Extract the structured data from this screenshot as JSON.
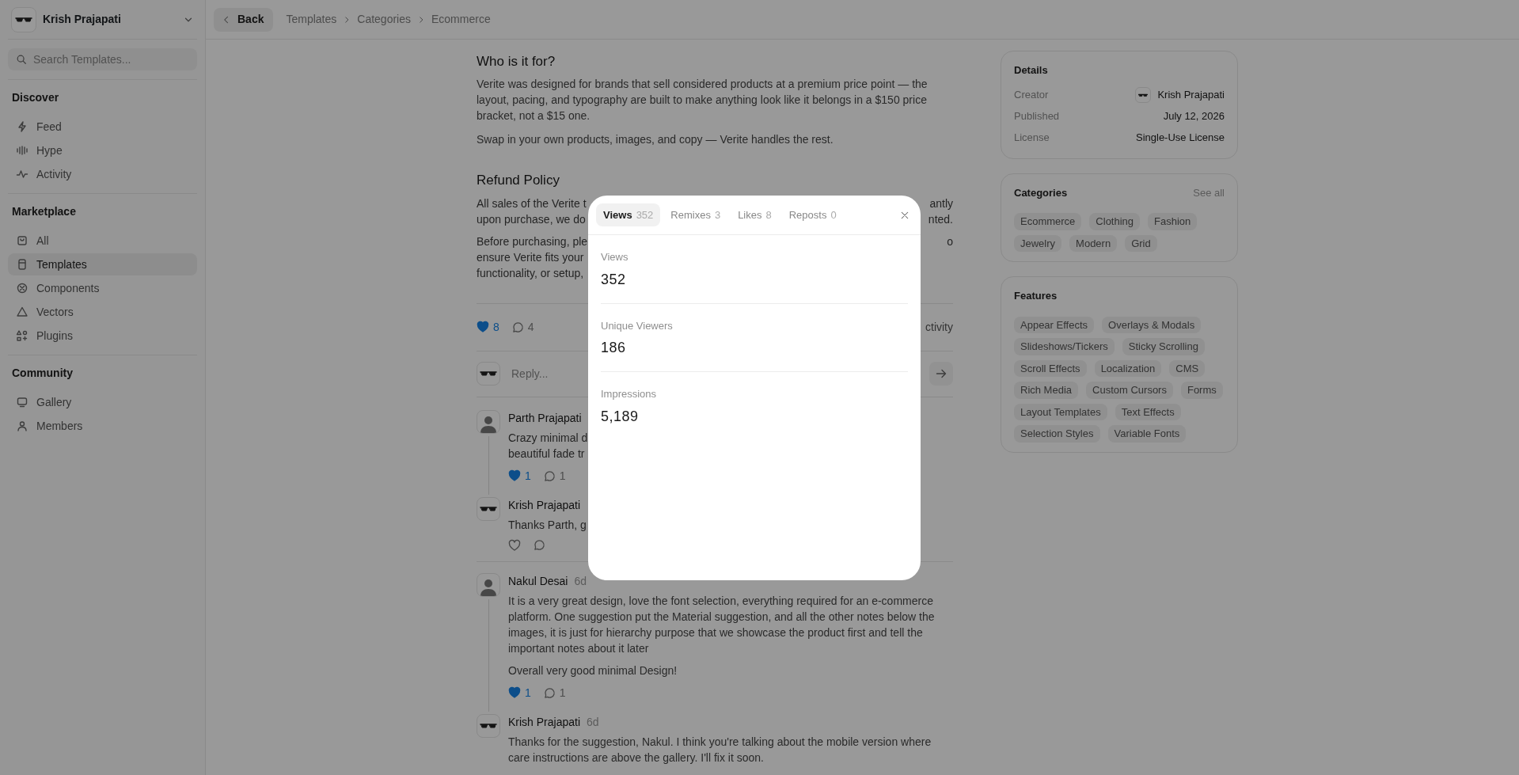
{
  "sidebar": {
    "profile": {
      "name": "Krish Prajapati"
    },
    "search": {
      "placeholder": "Search Templates..."
    },
    "sections": [
      {
        "title": "Discover",
        "items": [
          {
            "label": "Feed",
            "selected": false
          },
          {
            "label": "Hype",
            "selected": false
          },
          {
            "label": "Activity",
            "selected": false
          }
        ]
      },
      {
        "title": "Marketplace",
        "items": [
          {
            "label": "All",
            "selected": false
          },
          {
            "label": "Templates",
            "selected": true
          },
          {
            "label": "Components",
            "selected": false
          },
          {
            "label": "Vectors",
            "selected": false
          },
          {
            "label": "Plugins",
            "selected": false
          }
        ]
      },
      {
        "title": "Community",
        "items": [
          {
            "label": "Gallery",
            "selected": false
          },
          {
            "label": "Members",
            "selected": false
          }
        ]
      }
    ]
  },
  "topbar": {
    "back": "Back",
    "breadcrumb": [
      "Templates",
      "Categories",
      "Ecommerce"
    ]
  },
  "article": [
    {
      "heading": "Who is it for?",
      "paragraphs": [
        {
          "text": "Verite was designed for brands that sell considered products at a premium price point — the layout, pacing, and typography are built to make anything look like it belongs in a $150 price bracket, not a $15 one."
        },
        {
          "text": "Swap in your own products, images, and copy — Verite handles the rest."
        }
      ]
    },
    {
      "heading": "Refund Policy",
      "paragraphs": [
        {
          "lines": [
            {
              "left": "All sales of the Verite t",
              "right": "antly"
            },
            {
              "left": "upon purchase, we do",
              "right": "nted."
            }
          ]
        },
        {
          "lines": [
            {
              "left": "Before purchasing, ple",
              "right": "o"
            },
            {
              "left": "ensure Verite fits your"
            },
            {
              "left": "functionality, or setup,"
            }
          ]
        }
      ]
    }
  ],
  "post_actions": {
    "likes": {
      "count": "8",
      "liked": true
    },
    "comments": "4",
    "activity": "ctivity"
  },
  "reply_box": {
    "placeholder": "Reply..."
  },
  "comments": [
    {
      "author": "Parth Prajapati",
      "kind": "person",
      "paragraphs": [
        {
          "lines": [
            {
              "left": "Crazy minimal d"
            },
            {
              "left": "beautiful fade tr"
            }
          ]
        }
      ],
      "likes": {
        "count": "1",
        "liked": true
      },
      "replies": "1",
      "children": [
        {
          "author": "Krish Prajapati",
          "kind": "sunglasses",
          "paragraphs": [
            {
              "lines": [
                {
                  "left": "Thanks Parth, g"
                }
              ]
            }
          ],
          "likes": {
            "liked": false
          }
        }
      ]
    },
    {
      "author": "Nakul Desai",
      "time": "6d",
      "kind": "person",
      "paragraphs": [
        {
          "text": "It is a very great design, love the font selection, everything required for an e-commerce platform. One suggestion put the Material suggestion, and all the other notes below the images, it is just for hierarchy purpose that we showcase the product first and tell the important notes about it later"
        },
        {
          "text": "Overall very good minimal Design!"
        }
      ],
      "likes": {
        "count": "1",
        "liked": true
      },
      "replies": "1",
      "children": [
        {
          "author": "Krish Prajapati",
          "time": "6d",
          "kind": "sunglasses",
          "paragraphs": [
            {
              "text": "Thanks for the suggestion, Nakul. I think you're talking about the mobile version where care instructions are above the gallery. I'll fix it soon."
            }
          ]
        }
      ]
    }
  ],
  "details": {
    "title": "Details",
    "rows": [
      {
        "label": "Creator",
        "value": "Krish Prajapati",
        "kind": "sunglasses"
      },
      {
        "label": "Published",
        "value": "July 12, 2026"
      },
      {
        "label": "License",
        "value": "Single-Use License"
      }
    ]
  },
  "categories": {
    "title": "Categories",
    "link": "See all",
    "tags": [
      "Ecommerce",
      "Clothing",
      "Fashion",
      "Jewelry",
      "Modern",
      "Grid"
    ]
  },
  "features": {
    "title": "Features",
    "tags": [
      "Appear Effects",
      "Overlays & Modals",
      "Slideshows/Tickers",
      "Sticky Scrolling",
      "Scroll Effects",
      "Localization",
      "CMS",
      "Rich Media",
      "Custom Cursors",
      "Forms",
      "Layout Templates",
      "Text Effects",
      "Selection Styles",
      "Variable Fonts"
    ]
  },
  "modal": {
    "tabs": [
      {
        "label": "Views",
        "count": "352",
        "selected": true
      },
      {
        "label": "Remixes",
        "count": "3",
        "selected": false
      },
      {
        "label": "Likes",
        "count": "8",
        "selected": false
      },
      {
        "label": "Reposts",
        "count": "0",
        "selected": false
      }
    ],
    "stats": [
      {
        "label": "Views",
        "value": "352"
      },
      {
        "label": "Unique Viewers",
        "value": "186"
      },
      {
        "label": "Impressions",
        "value": "5,189"
      }
    ]
  }
}
